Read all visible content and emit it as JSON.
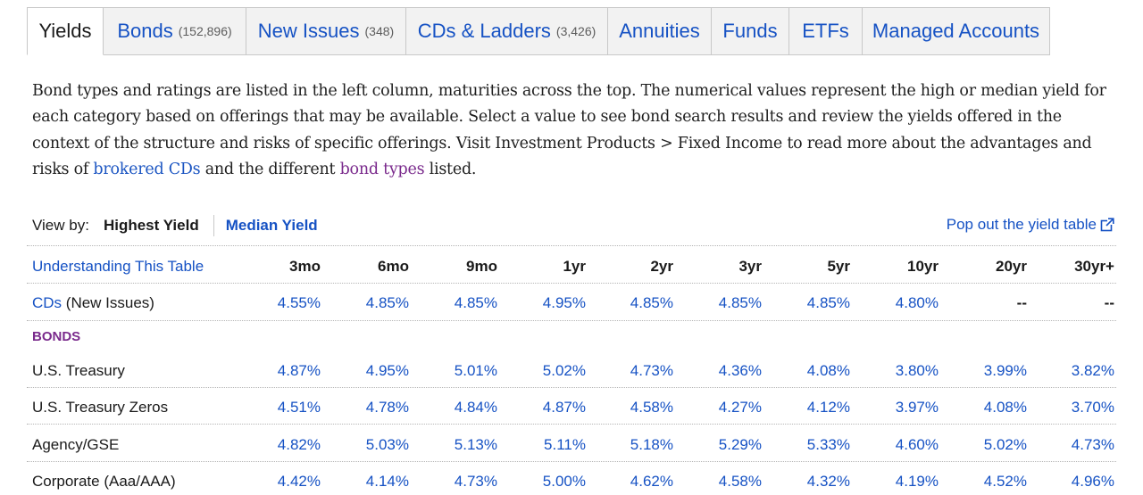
{
  "tabs": [
    {
      "label": "Yields",
      "count": "",
      "active": true
    },
    {
      "label": "Bonds",
      "count": "(152,896)"
    },
    {
      "label": "New Issues",
      "count": "(348)"
    },
    {
      "label": "CDs & Ladders",
      "count": "(3,426)"
    },
    {
      "label": "Annuities",
      "count": ""
    },
    {
      "label": "Funds",
      "count": ""
    },
    {
      "label": "ETFs",
      "count": ""
    },
    {
      "label": "Managed Accounts",
      "count": ""
    }
  ],
  "description": {
    "text_before": "Bond types and ratings are listed in the left column, maturities across the top. The numerical values represent the high or median yield for each category based on offerings that may be available. Select a value to see bond search results and review the yields offered in the context of the structure and risks of specific offerings. Visit Investment Products > Fixed Income to read more about the advantages and risks of ",
    "link_cds": "brokered CDs",
    "text_middle": " and the different ",
    "link_bond_types": "bond types",
    "text_after": " listed."
  },
  "view_by": {
    "label": "View by:",
    "active_option": "Highest Yield",
    "other_option": "Median Yield"
  },
  "popout_label": "Pop out the yield table",
  "table": {
    "header_link": "Understanding This Table",
    "columns": [
      "3mo",
      "6mo",
      "9mo",
      "1yr",
      "2yr",
      "3yr",
      "5yr",
      "10yr",
      "20yr",
      "30yr+"
    ],
    "cds_row": {
      "link": "CDs",
      "suffix": " (New Issues)",
      "values": [
        "4.55%",
        "4.85%",
        "4.85%",
        "4.95%",
        "4.85%",
        "4.85%",
        "4.85%",
        "4.80%",
        "--",
        "--"
      ]
    },
    "section_label": "BONDS",
    "rows": [
      {
        "name": "U.S. Treasury",
        "values": [
          "4.87%",
          "4.95%",
          "5.01%",
          "5.02%",
          "4.73%",
          "4.36%",
          "4.08%",
          "3.80%",
          "3.99%",
          "3.82%"
        ]
      },
      {
        "name": "U.S. Treasury Zeros",
        "values": [
          "4.51%",
          "4.78%",
          "4.84%",
          "4.87%",
          "4.58%",
          "4.27%",
          "4.12%",
          "3.97%",
          "4.08%",
          "3.70%"
        ]
      },
      {
        "name": "Agency/GSE",
        "values": [
          "4.82%",
          "5.03%",
          "5.13%",
          "5.11%",
          "5.18%",
          "5.29%",
          "5.33%",
          "4.60%",
          "5.02%",
          "4.73%"
        ]
      },
      {
        "name": "Corporate (Aaa/AAA)",
        "values": [
          "4.42%",
          "4.14%",
          "4.73%",
          "5.00%",
          "4.62%",
          "4.58%",
          "4.32%",
          "4.19%",
          "4.52%",
          "4.96%"
        ]
      }
    ]
  },
  "colors": {
    "link_blue": "#1652c4",
    "section_purple": "#7a2a8c",
    "tab_background": "#f2f2f2"
  }
}
